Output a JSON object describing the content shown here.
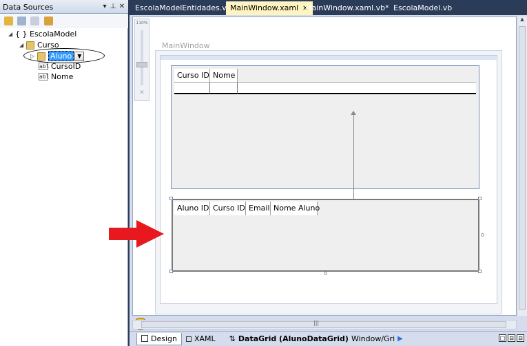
{
  "data_sources": {
    "title": "Data Sources",
    "title_buttons": [
      "▾",
      "⊥",
      "✕"
    ],
    "toolbar_icons": [
      "database-add-icon",
      "edit-icon",
      "configure-icon",
      "refresh-icon"
    ],
    "tree": {
      "root": "{ } EscolaModel",
      "curso": "Curso",
      "aluno": "Aluno",
      "fields": [
        "CursoID",
        "Nome"
      ]
    }
  },
  "tabs": [
    {
      "label": "EscolaModelEntidades.vb",
      "active": false
    },
    {
      "label": "MainWindow.xaml",
      "active": true
    },
    {
      "label": "MainWindow.xaml.vb*",
      "active": false
    },
    {
      "label": "EscolaModel.vb",
      "active": false
    }
  ],
  "zoom": {
    "value": "110%"
  },
  "window": {
    "title": "MainWindow"
  },
  "grid_top": {
    "headers": [
      "Curso ID",
      "Nome"
    ]
  },
  "grid_bottom": {
    "headers": [
      "Aluno ID",
      "Curso ID",
      "Email",
      "Nome Aluno"
    ]
  },
  "statusbar": {
    "design_tab": "Design",
    "xaml_tab": "XAML",
    "swap_icon": "⇅",
    "crumb": "DataGrid (AlunoDataGrid)",
    "crumb2": "Window/Gri",
    "crumb_arrow": "▶",
    "right_buttons": [
      "□",
      "⊟",
      "⊟"
    ]
  },
  "colors": {
    "accent_selection": "#3399ff",
    "red_arrow": "#e8191e",
    "active_tab": "#fdf4bf",
    "grid_border": "#6f89b4"
  }
}
